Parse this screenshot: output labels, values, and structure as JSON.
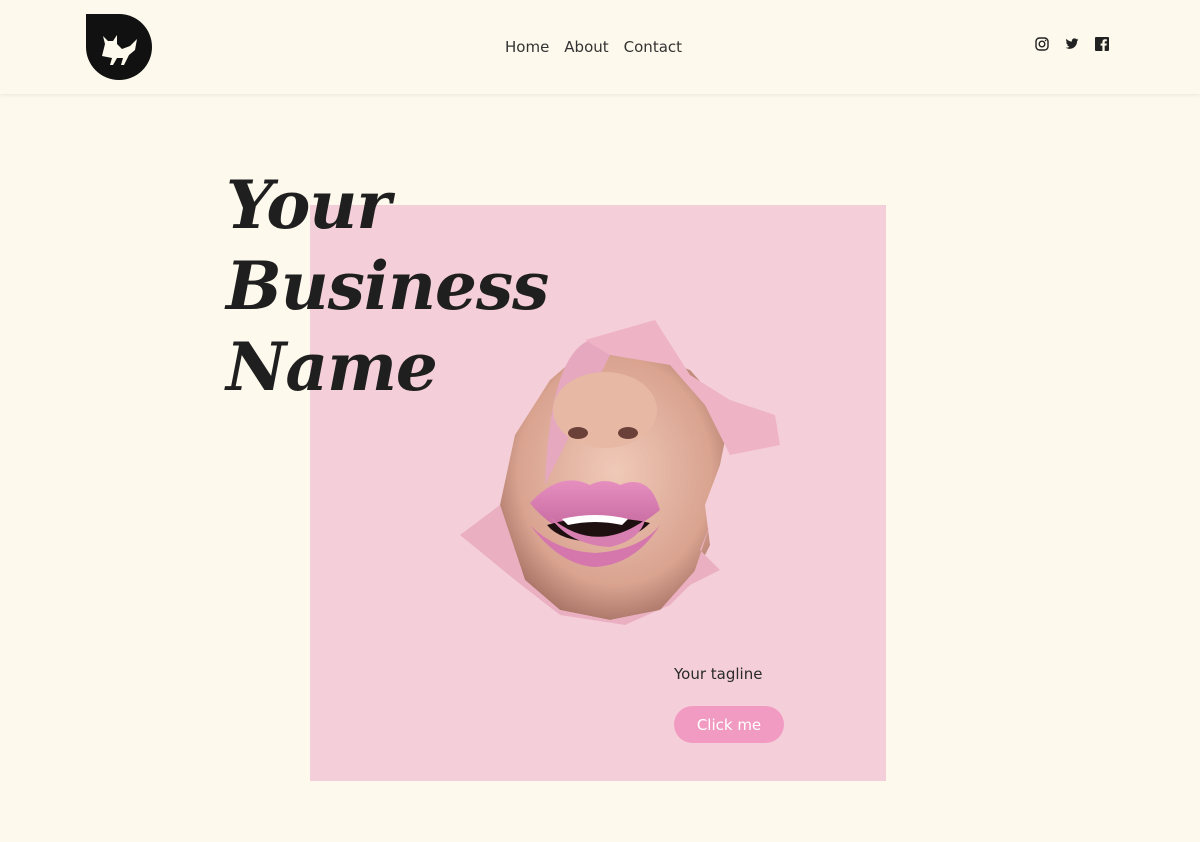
{
  "brand": {
    "logo_icon": "fox-in-shield-icon"
  },
  "nav": {
    "items": [
      {
        "label": "Home"
      },
      {
        "label": "About"
      },
      {
        "label": "Contact"
      }
    ]
  },
  "social": {
    "icons": [
      "instagram-icon",
      "twitter-icon",
      "facebook-icon"
    ]
  },
  "hero": {
    "title_lines": [
      "Your",
      "Business",
      "Name"
    ],
    "tagline": "Your tagline",
    "button_label": "Click me",
    "image": "pink-torn-paper-lips-photo"
  },
  "colors": {
    "background": "#fdf9ec",
    "accent": "#f29bc2",
    "image_pink": "#f4cfd9",
    "text": "#222222"
  }
}
